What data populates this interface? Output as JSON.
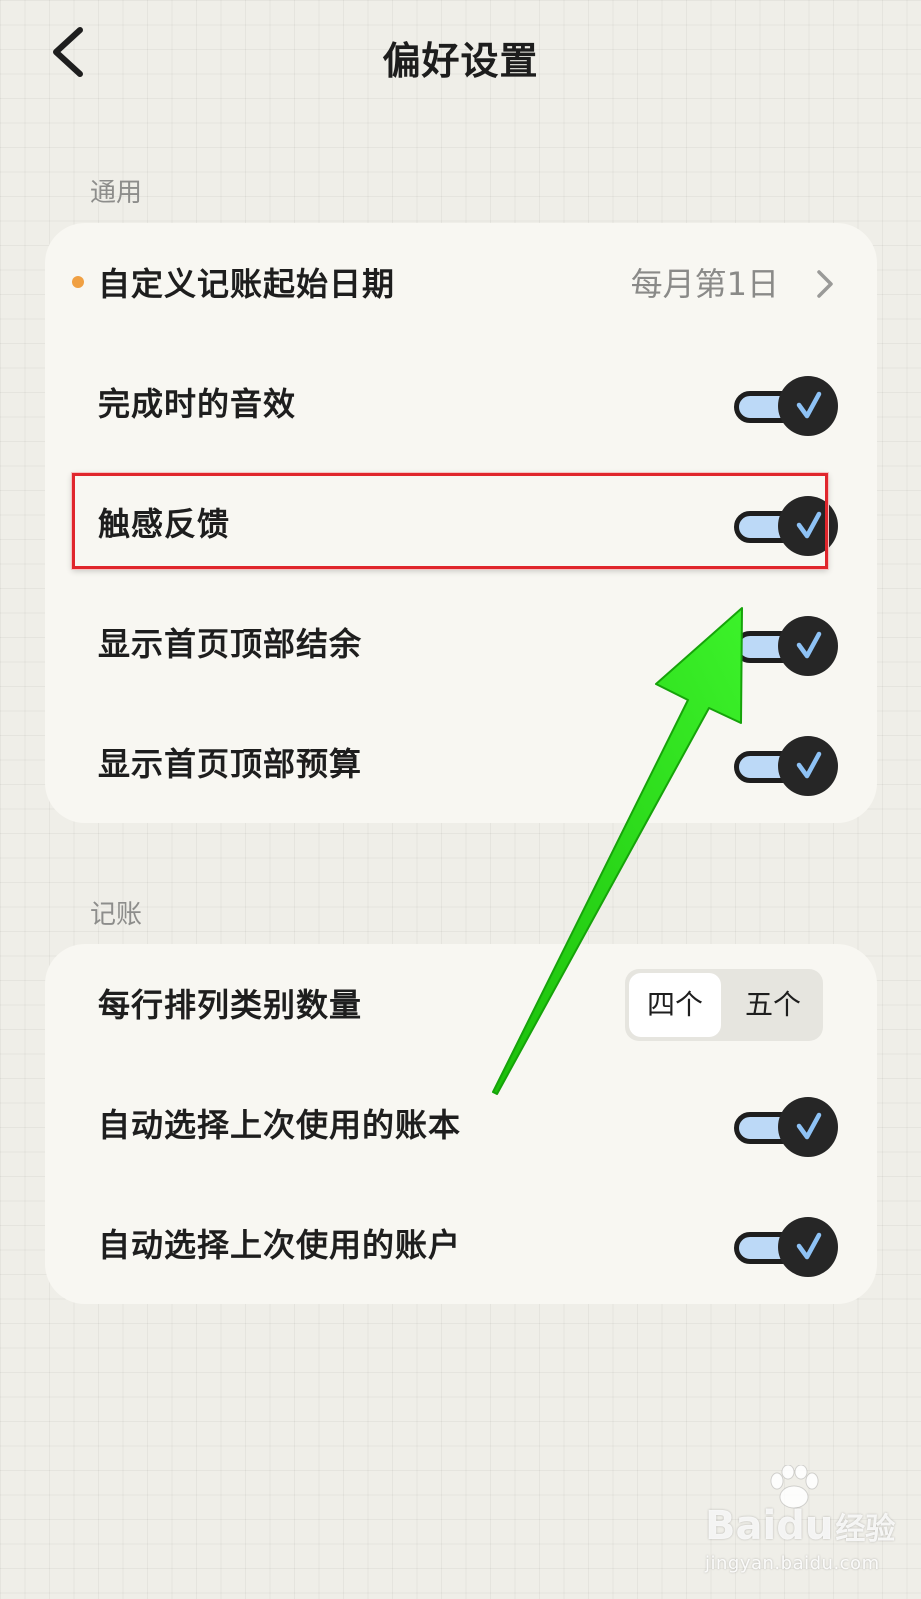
{
  "header": {
    "title": "偏好设置",
    "back_icon": "chevron-left-icon"
  },
  "sections": [
    {
      "label": "通用",
      "rows": [
        {
          "label": "自定义记账起始日期",
          "value": "每月第1日",
          "has_dot": true,
          "dot_color": "#f0a043"
        },
        {
          "label": "完成时的音效",
          "toggle": true
        },
        {
          "label": "触感反馈",
          "toggle": true,
          "highlighted": true
        },
        {
          "label": "显示首页顶部结余",
          "toggle": true
        },
        {
          "label": "显示首页顶部预算",
          "toggle": true
        }
      ]
    },
    {
      "label": "记账",
      "rows": [
        {
          "label": "每行排列类别数量",
          "options": [
            "四个",
            "五个"
          ],
          "selected": "四个"
        },
        {
          "label": "自动选择上次使用的账本",
          "toggle": true
        },
        {
          "label": "自动选择上次使用的账户",
          "toggle": true
        }
      ]
    }
  ],
  "colors": {
    "background": "#efeee8",
    "card": "#f8f7f2",
    "toggle_track": "#bcd9f7",
    "toggle_knob": "#262626",
    "check": "#8ec2f5",
    "highlight_border": "#e0262c",
    "arrow": "#22dd11"
  },
  "watermark": {
    "brand": "Bai",
    "brand_suffix": "du",
    "brand_cn": "经验",
    "url": "jingyan.baidu.com"
  }
}
